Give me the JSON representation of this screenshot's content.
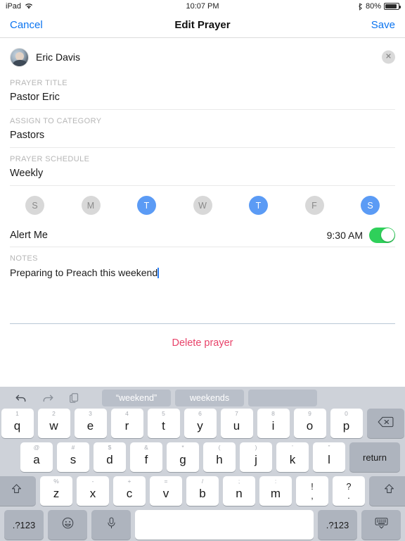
{
  "status_bar": {
    "device": "iPad",
    "wifi_icon": "wifi-icon",
    "time": "10:07 PM",
    "bluetooth_icon": "bluetooth-icon",
    "battery_percent": "80%",
    "battery_icon": "battery-icon"
  },
  "nav": {
    "cancel_label": "Cancel",
    "title": "Edit Prayer",
    "save_label": "Save"
  },
  "user": {
    "name": "Eric Davis",
    "avatar_icon": "avatar-photo",
    "close_icon": "close-icon"
  },
  "fields": {
    "prayer_title_label": "PRAYER TITLE",
    "prayer_title_value": "Pastor Eric",
    "category_label": "ASSIGN TO CATEGORY",
    "category_value": "Pastors",
    "schedule_label": "PRAYER SCHEDULE",
    "schedule_value": "Weekly",
    "notes_label": "NOTES",
    "notes_value": "Preparing to Preach this weekend"
  },
  "days": [
    {
      "label": "S",
      "selected": false
    },
    {
      "label": "M",
      "selected": false
    },
    {
      "label": "T",
      "selected": true
    },
    {
      "label": "W",
      "selected": false
    },
    {
      "label": "T",
      "selected": true
    },
    {
      "label": "F",
      "selected": false
    },
    {
      "label": "S",
      "selected": true
    }
  ],
  "alert": {
    "label": "Alert Me",
    "time": "9:30 AM",
    "toggle_on": true,
    "toggle_color": "#2fd05a"
  },
  "delete": {
    "label": "Delete prayer",
    "color": "#e8436a"
  },
  "colors": {
    "accent_blue": "#0b74f0",
    "day_selected": "#5b9bf5",
    "day_unselected": "#d8d8d8",
    "divider_blue": "#b9c8d6"
  },
  "keyboard": {
    "undo_icon": "undo-icon",
    "redo_icon": "redo-icon",
    "paste_icon": "paste-icon",
    "suggestions": [
      "“weekend”",
      "weekends",
      ""
    ],
    "row1": [
      {
        "sub": "1",
        "main": "q"
      },
      {
        "sub": "2",
        "main": "w"
      },
      {
        "sub": "3",
        "main": "e"
      },
      {
        "sub": "4",
        "main": "r"
      },
      {
        "sub": "5",
        "main": "t"
      },
      {
        "sub": "6",
        "main": "y"
      },
      {
        "sub": "7",
        "main": "u"
      },
      {
        "sub": "8",
        "main": "i"
      },
      {
        "sub": "9",
        "main": "o"
      },
      {
        "sub": "0",
        "main": "p"
      }
    ],
    "backspace_icon": "backspace-icon",
    "row2": [
      {
        "sub": "@",
        "main": "a"
      },
      {
        "sub": "#",
        "main": "s"
      },
      {
        "sub": "$",
        "main": "d"
      },
      {
        "sub": "&",
        "main": "f"
      },
      {
        "sub": "*",
        "main": "g"
      },
      {
        "sub": "(",
        "main": "h"
      },
      {
        "sub": ")",
        "main": "j"
      },
      {
        "sub": "’",
        "main": "k"
      },
      {
        "sub": "”",
        "main": "l"
      }
    ],
    "return_label": "return",
    "row3": [
      {
        "sub": "%",
        "main": "z"
      },
      {
        "sub": "-",
        "main": "x"
      },
      {
        "sub": "+",
        "main": "c"
      },
      {
        "sub": "=",
        "main": "v"
      },
      {
        "sub": "/",
        "main": "b"
      },
      {
        "sub": ";",
        "main": "n"
      },
      {
        "sub": ":",
        "main": "m"
      }
    ],
    "punct_keys": [
      {
        "up": "!",
        "dn": ","
      },
      {
        "up": "?",
        "dn": "."
      }
    ],
    "shift_left_icon": "shift-icon",
    "shift_right_icon": "shift-icon",
    "numeric_left_label": ".?123",
    "numeric_right_label": ".?123",
    "emoji_icon": "emoji-icon",
    "mic_icon": "microphone-icon",
    "space_label": "",
    "hide_keyboard_icon": "hide-keyboard-icon"
  }
}
